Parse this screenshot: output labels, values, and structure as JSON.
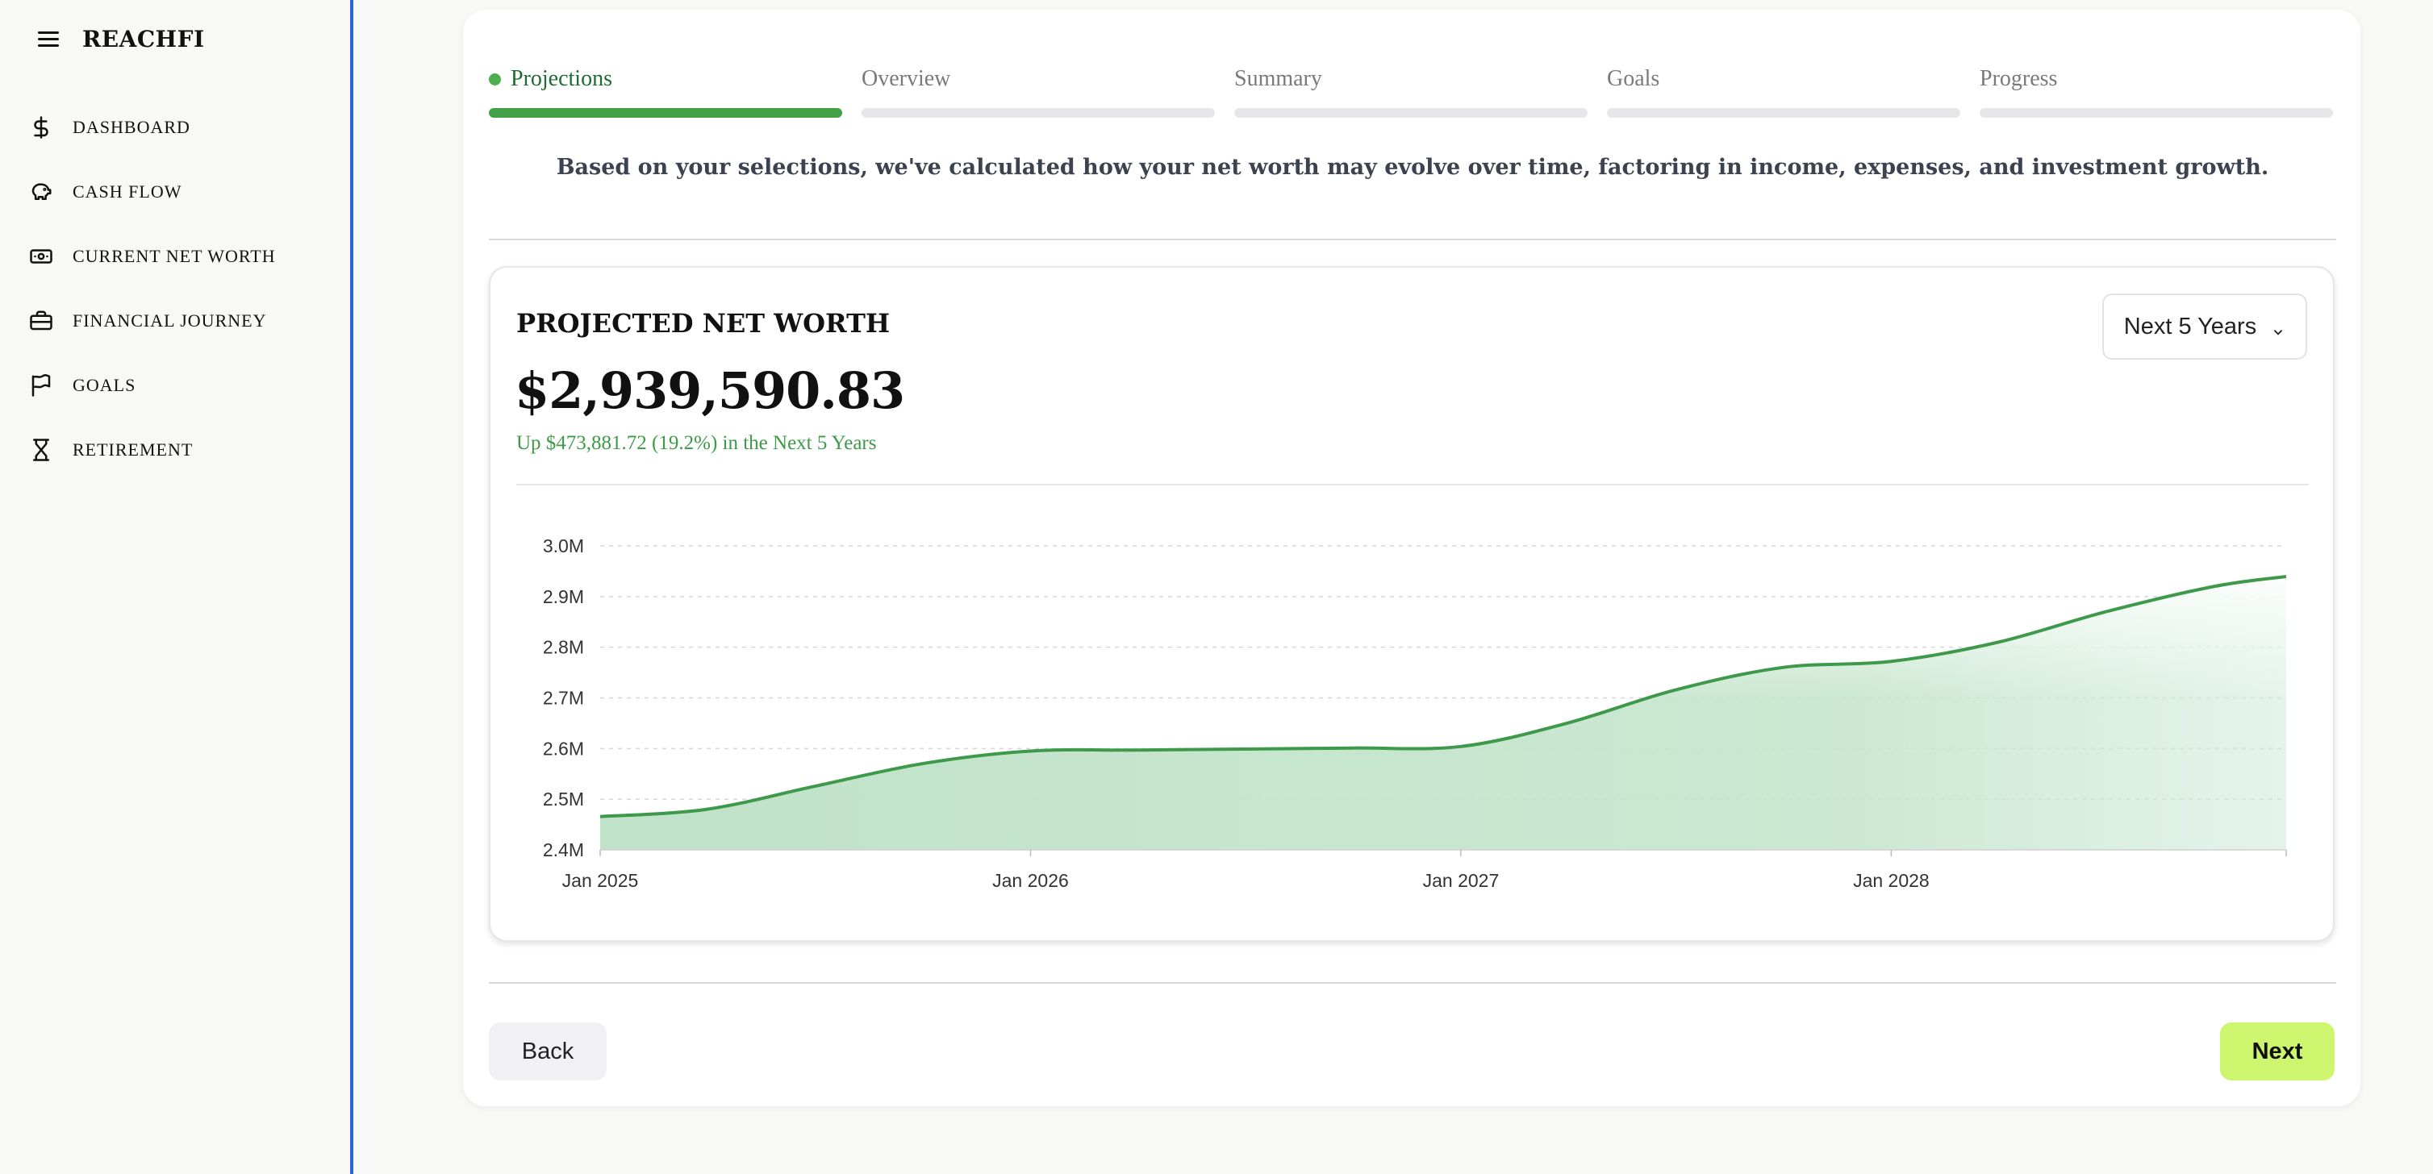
{
  "brand": {
    "name": "REACHFI"
  },
  "sidebar": {
    "items": [
      {
        "label": "DASHBOARD",
        "icon": "dollar-icon"
      },
      {
        "label": "CASH FLOW",
        "icon": "piggy-bank-icon"
      },
      {
        "label": "CURRENT NET WORTH",
        "icon": "banknote-icon"
      },
      {
        "label": "FINANCIAL JOURNEY",
        "icon": "briefcase-icon"
      },
      {
        "label": "GOALS",
        "icon": "flag-icon"
      },
      {
        "label": "RETIREMENT",
        "icon": "hourglass-icon"
      }
    ]
  },
  "steps": [
    {
      "label": "Projections",
      "active": true
    },
    {
      "label": "Overview",
      "active": false
    },
    {
      "label": "Summary",
      "active": false
    },
    {
      "label": "Goals",
      "active": false
    },
    {
      "label": "Progress",
      "active": false
    }
  ],
  "description": "Based on your selections, we've calculated how your net worth may evolve over time, factoring in income, expenses, and investment growth.",
  "projection": {
    "title": "PROJECTED NET WORTH",
    "value": "$2,939,590.83",
    "change": "Up $473,881.72 (19.2%) in the Next 5 Years",
    "range_select": "Next 5 Years"
  },
  "buttons": {
    "back": "Back",
    "next": "Next"
  },
  "colors": {
    "accent": "#43a047",
    "line": "#3e9a4a",
    "area": "#bfe2c8",
    "next_button": "#cdf66e",
    "sidebar_border": "#2f62d6"
  },
  "chart_data": {
    "type": "area",
    "x": [
      "2025-01",
      "2025-04",
      "2025-07",
      "2025-10",
      "2026-01",
      "2026-04",
      "2026-07",
      "2026-10",
      "2027-01",
      "2027-04",
      "2027-07",
      "2027-10",
      "2028-01",
      "2028-04",
      "2028-07",
      "2028-10",
      "2028-12"
    ],
    "values": [
      2465709,
      2480000,
      2525000,
      2570000,
      2595000,
      2597000,
      2599000,
      2601000,
      2604000,
      2650000,
      2715000,
      2760000,
      2772000,
      2810000,
      2870000,
      2920000,
      2939591
    ],
    "yticks": [
      "2.4M",
      "2.5M",
      "2.6M",
      "2.7M",
      "2.8M",
      "2.9M",
      "3.0M"
    ],
    "xticks": [
      "Jan 2025",
      "Jan 2026",
      "Jan 2027",
      "Jan 2028"
    ],
    "ylim": [
      2400000,
      3000000
    ],
    "grid": true
  }
}
